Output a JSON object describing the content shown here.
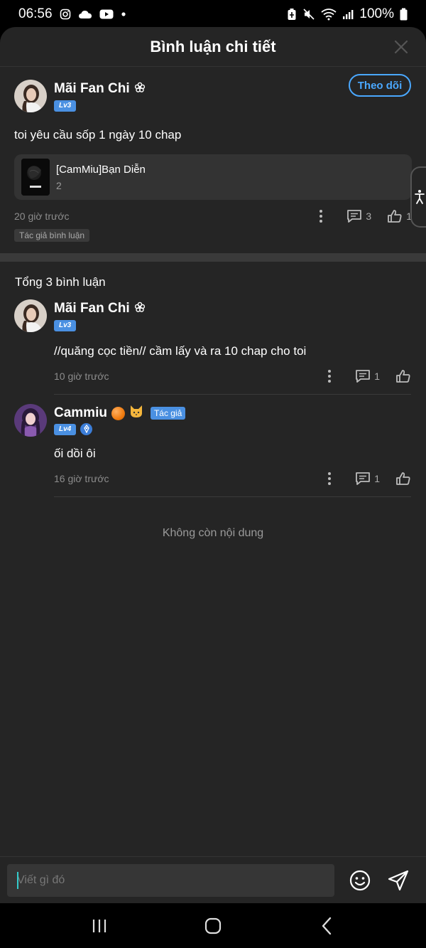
{
  "status_bar": {
    "time": "06:56",
    "battery": "100%"
  },
  "sheet": {
    "title": "Bình luận chi tiết"
  },
  "main_comment": {
    "user_name": "Mãi Fan Chi",
    "level": "Lv3",
    "follow_label": "Theo dõi",
    "text": "toi yêu cầu sốp 1 ngày 10 chap",
    "chapter": {
      "title": "[CamMiu]Bạn Diễn",
      "number": "2"
    },
    "time": "20 giờ trước",
    "reply_count": "3",
    "like_count": "1",
    "tag": "Tác giả bình luận"
  },
  "replies_section": {
    "total_label": "Tổng 3 bình luận",
    "replies": [
      {
        "user_name": "Mãi Fan Chi",
        "level": "Lv3",
        "text": "//quăng cọc tiền// cầm lấy và ra 10 chap cho toi",
        "time": "10 giờ trước",
        "reply_count": "1"
      },
      {
        "user_name": "Cammiu",
        "level": "Lv4",
        "author_label": "Tác giả",
        "text": "ối dồi ôi",
        "time": "16 giờ trước",
        "reply_count": "1"
      }
    ],
    "end_text": "Không còn nội dung"
  },
  "input": {
    "placeholder": "Viết gì đó"
  },
  "colors": {
    "accent": "#4aa8ff",
    "badge": "#4a90e2",
    "background": "#252525"
  }
}
